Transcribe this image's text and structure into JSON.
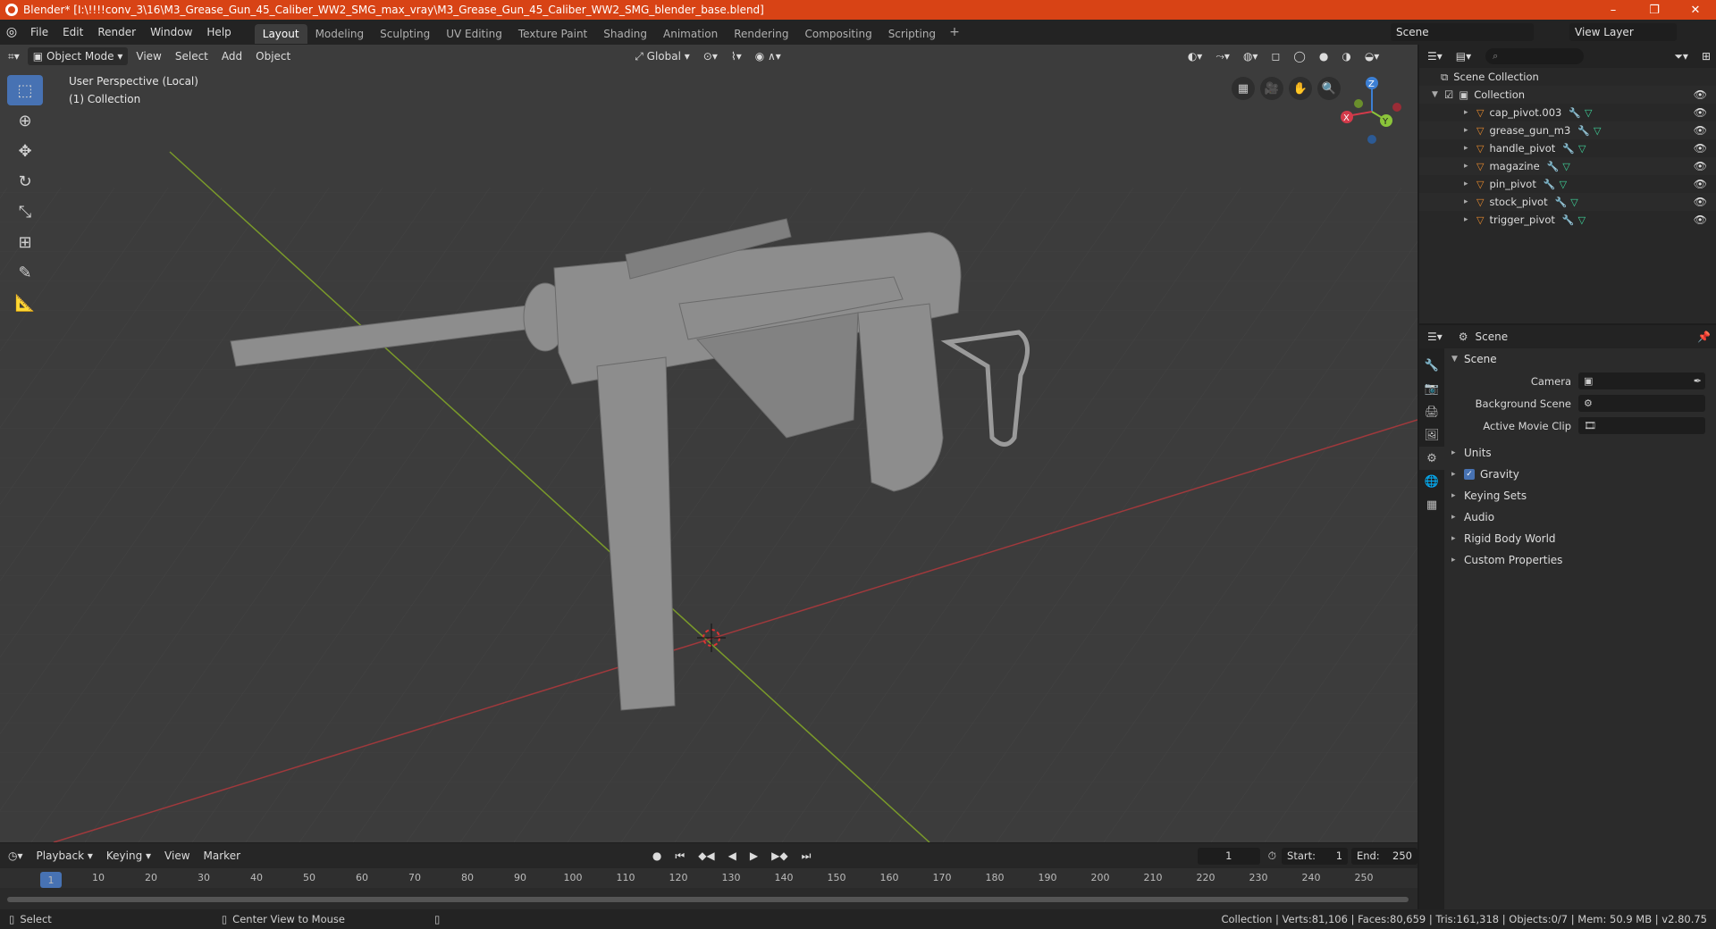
{
  "window": {
    "title": "Blender* [I:\\!!!!conv_3\\16\\M3_Grease_Gun_45_Caliber_WW2_SMG_max_vray\\M3_Grease_Gun_45_Caliber_WW2_SMG_blender_base.blend]",
    "minimize": "–",
    "maximize": "❐",
    "close": "✕"
  },
  "menubar": {
    "items": [
      "File",
      "Edit",
      "Render",
      "Window",
      "Help"
    ],
    "workspaces": [
      "Layout",
      "Modeling",
      "Sculpting",
      "UV Editing",
      "Texture Paint",
      "Shading",
      "Animation",
      "Rendering",
      "Compositing",
      "Scripting"
    ],
    "active_workspace": "Layout",
    "add_workspace": "+",
    "scene": "Scene",
    "view_layer": "View Layer"
  },
  "viewport": {
    "mode": "Object Mode",
    "menus": [
      "View",
      "Select",
      "Add",
      "Object"
    ],
    "orientation": "Global",
    "overlay_line1": "User Perspective (Local)",
    "overlay_line2": "(1) Collection",
    "gizmo": {
      "x": "X",
      "y": "Y",
      "z": "Z"
    }
  },
  "outliner": {
    "root": "Scene Collection",
    "collection": "Collection",
    "objects": [
      "cap_pivot.003",
      "grease_gun_m3",
      "handle_pivot",
      "magazine",
      "pin_pivot",
      "stock_pivot",
      "trigger_pivot"
    ]
  },
  "properties": {
    "context": "Scene",
    "panel": "Scene",
    "camera_label": "Camera",
    "background_scene_label": "Background Scene",
    "active_movie_clip_label": "Active Movie Clip",
    "subpanels": {
      "units": "Units",
      "gravity": "Gravity",
      "keying_sets": "Keying Sets",
      "audio": "Audio",
      "rigid_body_world": "Rigid Body World",
      "custom_properties": "Custom Properties"
    },
    "gravity_checked": true
  },
  "timeline": {
    "menus": [
      "Playback",
      "Keying",
      "View",
      "Marker"
    ],
    "current_frame": "1",
    "start_label": "Start:",
    "start": "1",
    "end_label": "End:",
    "end": "250",
    "ruler_marks": [
      "1",
      "10",
      "20",
      "30",
      "40",
      "50",
      "60",
      "70",
      "80",
      "90",
      "100",
      "110",
      "120",
      "130",
      "140",
      "150",
      "160",
      "170",
      "180",
      "190",
      "200",
      "210",
      "220",
      "230",
      "240",
      "250"
    ]
  },
  "statusbar": {
    "select": "Select",
    "center_view": "Center View to Mouse",
    "stats": "Collection | Verts:81,106 | Faces:80,659 | Tris:161,318 | Objects:0/7 | Mem: 50.9 MB | v2.80.75"
  }
}
